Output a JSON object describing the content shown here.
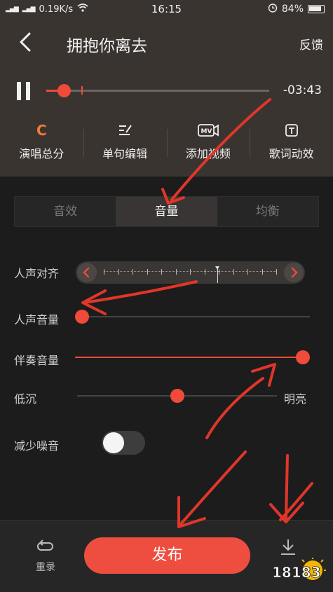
{
  "status_bar": {
    "network_speed": "0.19K/s",
    "time": "16:15",
    "battery": "84%"
  },
  "header": {
    "title": "拥抱你离去",
    "feedback_label": "反馈"
  },
  "player": {
    "remaining_time": "-03:43",
    "progress": 0.08
  },
  "tools": [
    {
      "icon": "score-c-icon",
      "glyph": "C",
      "label": "演唱总分"
    },
    {
      "icon": "edit-line-icon",
      "glyph": "✎",
      "label": "单句编辑"
    },
    {
      "icon": "mv-camera-icon",
      "glyph": "MV",
      "label": "添加视频"
    },
    {
      "icon": "lyrics-effect-icon",
      "glyph": "T",
      "label": "歌词动效"
    }
  ],
  "tabs": [
    {
      "label": "音效",
      "active": false
    },
    {
      "label": "音量",
      "active": true
    },
    {
      "label": "均衡",
      "active": false
    }
  ],
  "controls": {
    "vocal_align_label": "人声对齐",
    "vocal_volume_label": "人声音量",
    "vocal_volume_level": 0.0,
    "accompaniment_label": "伴奏音量",
    "accompaniment_level": 1.0,
    "tone_low_label": "低沉",
    "tone_high_label": "明亮",
    "tone_level": 0.5,
    "noise_label": "减少噪音",
    "noise_reduction_on": false
  },
  "bottom": {
    "rerecord_label": "重录",
    "publish_label": "发布"
  },
  "watermark": {
    "text": "18183"
  },
  "colors": {
    "accent": "#ef4a3a",
    "score_icon": "#f07a3a",
    "annotation": "#e0362a"
  }
}
